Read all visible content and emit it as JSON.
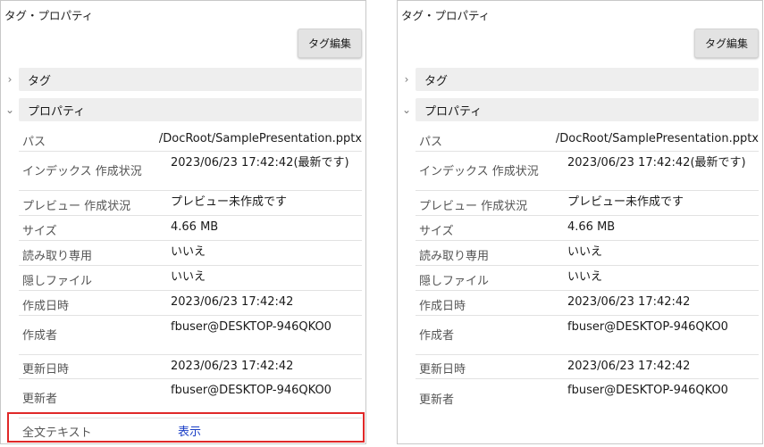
{
  "panels": [
    {
      "title": "タグ・プロパティ",
      "tag_edit_label": "タグ編集",
      "sections": {
        "tag": "タグ",
        "property": "プロパティ"
      },
      "chevrons": {
        "tag": "›",
        "property": "⌄"
      },
      "properties": {
        "path": {
          "key": "パス",
          "value": "/DocRoot/SamplePresentation.pptx"
        },
        "index": {
          "key": "インデックス 作成状況",
          "value": "2023/06/23 17:42:42(最新です)"
        },
        "preview": {
          "key": "プレビュー 作成状況",
          "value": "プレビュー未作成です"
        },
        "size": {
          "key": "サイズ",
          "value": "4.66 MB"
        },
        "readonly": {
          "key": "読み取り専用",
          "value": "いいえ"
        },
        "hidden": {
          "key": "隠しファイル",
          "value": "いいえ"
        },
        "created": {
          "key": "作成日時",
          "value": "2023/06/23 17:42:42"
        },
        "creator": {
          "key": "作成者",
          "value": "fbuser@DESKTOP-946QKO0"
        },
        "modified": {
          "key": "更新日時",
          "value": "2023/06/23 17:42:42"
        },
        "modifier": {
          "key": "更新者",
          "value": "fbuser@DESKTOP-946QKO0"
        },
        "fulltext": {
          "key": "全文テキスト",
          "value": "表示"
        }
      }
    },
    {
      "title": "タグ・プロパティ",
      "tag_edit_label": "タグ編集",
      "sections": {
        "tag": "タグ",
        "property": "プロパティ"
      },
      "chevrons": {
        "tag": "›",
        "property": "⌄"
      },
      "properties": {
        "path": {
          "key": "パス",
          "value": "/DocRoot/SamplePresentation.pptx"
        },
        "index": {
          "key": "インデックス 作成状況",
          "value": "2023/06/23 17:42:42(最新です)"
        },
        "preview": {
          "key": "プレビュー 作成状況",
          "value": "プレビュー未作成です"
        },
        "size": {
          "key": "サイズ",
          "value": "4.66 MB"
        },
        "readonly": {
          "key": "読み取り専用",
          "value": "いいえ"
        },
        "hidden": {
          "key": "隠しファイル",
          "value": "いいえ"
        },
        "created": {
          "key": "作成日時",
          "value": "2023/06/23 17:42:42"
        },
        "creator": {
          "key": "作成者",
          "value": "fbuser@DESKTOP-946QKO0"
        },
        "modified": {
          "key": "更新日時",
          "value": "2023/06/23 17:42:42"
        },
        "modifier": {
          "key": "更新者",
          "value": "fbuser@DESKTOP-946QKO0"
        }
      }
    }
  ],
  "colors": {
    "highlight": "#e02828",
    "link": "#1a3ec6"
  }
}
